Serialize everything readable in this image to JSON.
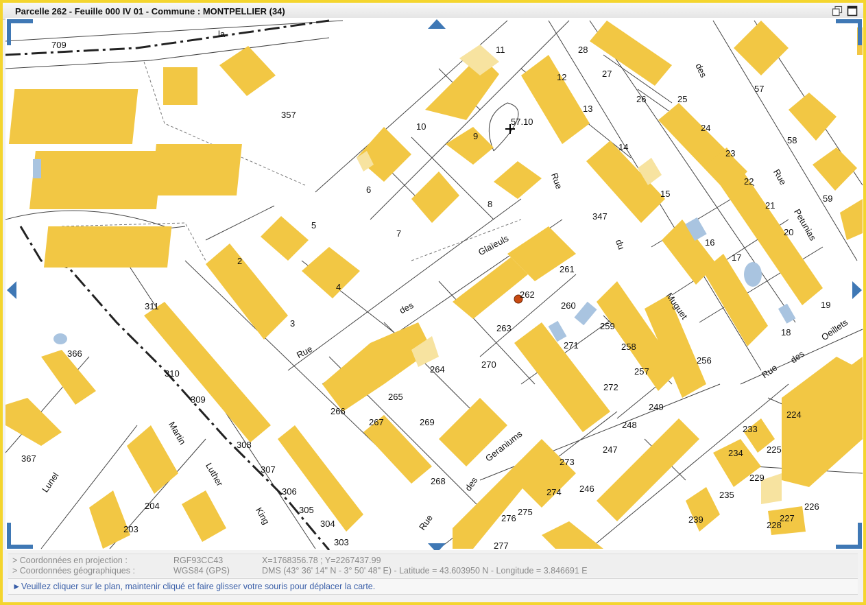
{
  "window": {
    "title": "Parcelle 262 - Feuille 000 IV 01 - Commune : MONTPELLIER (34)"
  },
  "map": {
    "parcel_labels": [
      "709",
      "357",
      "11",
      "12",
      "28",
      "27",
      "26",
      "25",
      "57",
      "10",
      "9",
      "57.10",
      "13",
      "24",
      "23",
      "58",
      "6",
      "8",
      "14",
      "22",
      "21",
      "59",
      "5",
      "7",
      "347",
      "15",
      "16",
      "20",
      "2",
      "4",
      "17",
      "261",
      "262",
      "311",
      "3",
      "260",
      "259",
      "19",
      "18",
      "263",
      "271",
      "258",
      "256",
      "366",
      "264",
      "270",
      "257",
      "310",
      "265",
      "272",
      "249",
      "224",
      "309",
      "266",
      "267",
      "269",
      "248",
      "233",
      "225",
      "308",
      "234",
      "307",
      "268",
      "273",
      "247",
      "229",
      "367",
      "204",
      "306",
      "274",
      "246",
      "235",
      "226",
      "305",
      "275",
      "239",
      "203",
      "276",
      "227",
      "304",
      "303",
      "277",
      "228"
    ],
    "street_labels": [
      "Rue",
      "des",
      "Glaïeuls",
      "Rue du Muguet",
      "Rue des Petunias",
      "Rue des Oeillets",
      "Rue des Geraniums",
      "Martin Luther King",
      "Lunel",
      "la"
    ],
    "selected_parcel": "262"
  },
  "coordinates": {
    "projection_label": "> Coordonnées en projection :",
    "projection_system": "RGF93CC43",
    "projection_value": "X=1768356.78 ; Y=2267437.99",
    "geographic_label": "> Coordonnées géographiques :",
    "geographic_system": "WGS84 (GPS)",
    "geographic_value": "DMS (43° 36' 14\" N - 3° 50' 48\" E) - Latitude = 43.603950 N - Longitude = 3.846691 E"
  },
  "hint": {
    "arrow": "►",
    "text": "Veuillez cliquer sur le plan, maintenir cliqué et faire glisser votre souris pour déplacer la carte."
  },
  "colors": {
    "frame": "#f4d52e",
    "building": "#f2c744",
    "building_light": "#f7e3a0",
    "water": "#a9c4e0",
    "nav_arrow": "#3f78b5",
    "hint_text": "#3a5fa8"
  },
  "icons": [
    "restore-window-icon",
    "maximize-window-icon",
    "pan-up-icon",
    "pan-down-icon",
    "pan-left-icon",
    "pan-right-icon",
    "crosshair-icon",
    "location-marker-icon"
  ]
}
